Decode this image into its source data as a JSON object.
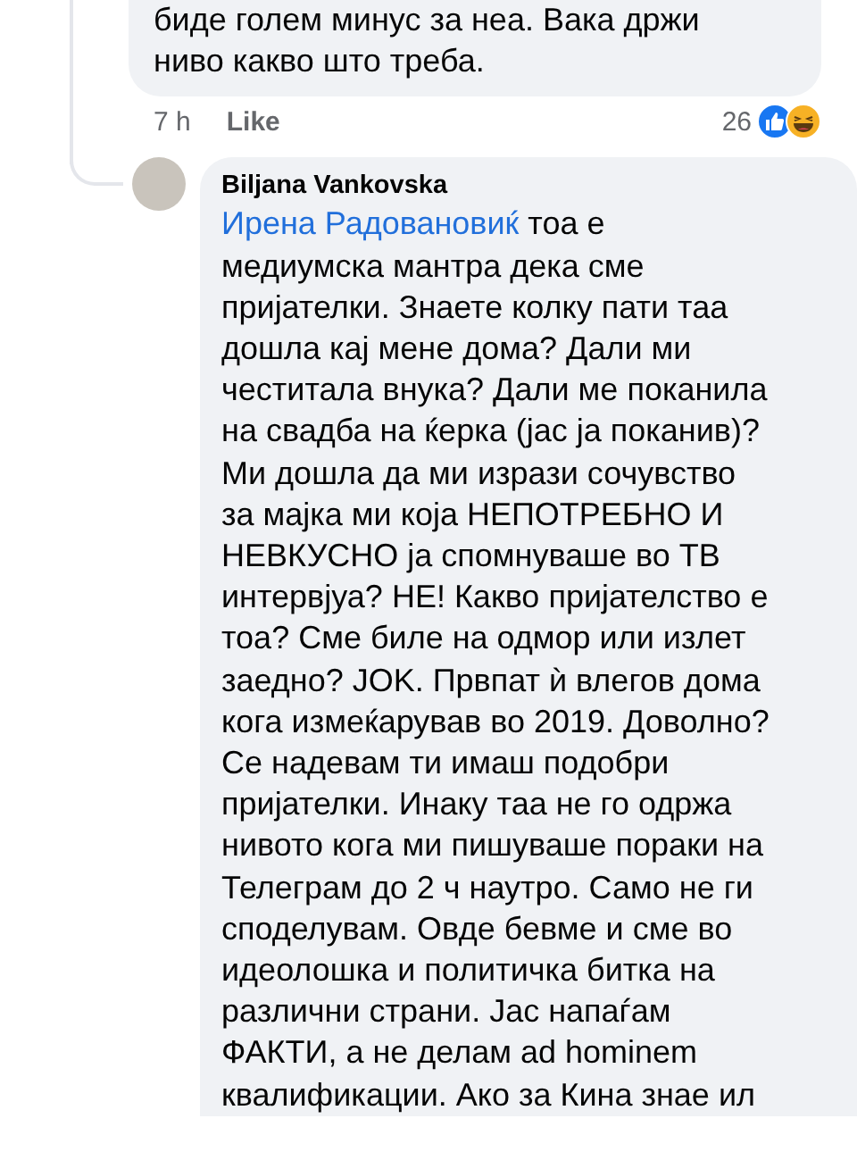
{
  "previous_comment": {
    "text": "биде голем минус за неа. Вака држи\nниво какво што треба.",
    "time": "7 h",
    "like_label": "Like",
    "reaction_count": "26"
  },
  "reply": {
    "author": "Biljana Vankovska",
    "mention": "Ирена Радовановиќ",
    "text": "тоа е\nмедиумска мантра дека сме\nпријателки. Знаете колку пати таа\nдошла кај мене дома? Дали ми\nчеститала внука? Дали ме поканила\nна свадба на ќерка (јас ја поканив)?\nМи дошла да ми изрази сочувство\nза мајка ми која НЕПОТРЕБНО И\nНЕВКУСНО ја спомнуваше во ТВ\nинтервјуа? НЕ! Какво пријателство е\nтоа? Сме биле на одмор или излет\nзаедно? JOK. Првпат ѝ влегов дома\nкога измеќарував во 2019. Доволно?\nСе надевам ти имаш подобри\nпријателки. Инаку таа не го одржа\nнивото кога ми пишуваше пораки на\nТелеграм до 2 ч наутро. Само не ги\nсподелувам. Овде бевме и сме во\nидеолошка и политичка битка на\nразлични страни. Јас напаѓам\nФАКТИ, а не делам ad hominem\nквалификации. Ако за Кина знае ил"
  }
}
